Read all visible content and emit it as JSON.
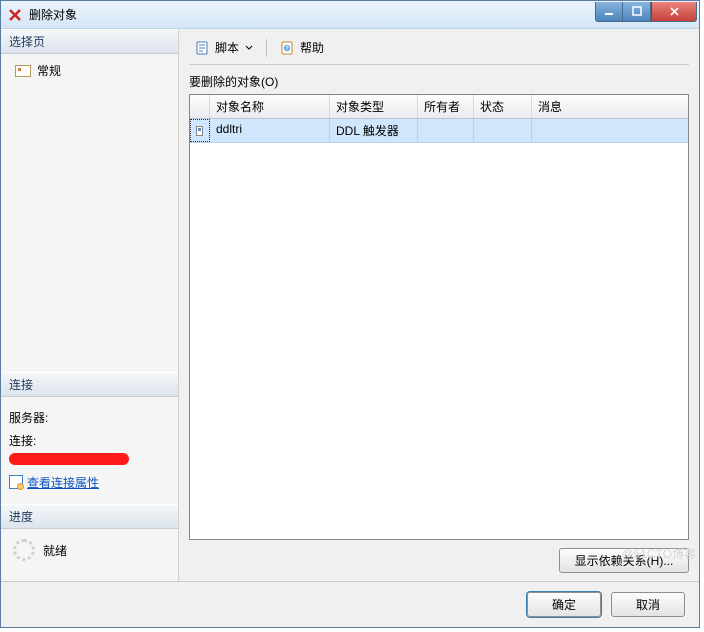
{
  "title": "删除对象",
  "sidebar": {
    "select_page": "选择页",
    "items": [
      {
        "label": "常规"
      }
    ],
    "connection_header": "连接",
    "server_label": "服务器:",
    "server_value": "",
    "conn_label": "连接:",
    "view_conn_props": "查看连接属性",
    "progress_header": "进度",
    "progress_status": "就绪"
  },
  "toolbar": {
    "script_label": "脚本",
    "help_label": "帮助"
  },
  "grid": {
    "label_prefix": "要删除的对象",
    "label_hotkey": "(O)",
    "headers": {
      "name": "对象名称",
      "type": "对象类型",
      "owner": "所有者",
      "state": "状态",
      "msg": "消息"
    },
    "rows": [
      {
        "name": "ddltri",
        "type": "DDL 触发器",
        "owner": "",
        "state": "",
        "msg": ""
      }
    ]
  },
  "buttons": {
    "show_deps": "显示依赖关系(H)...",
    "ok": "确定",
    "cancel": "取消"
  },
  "watermark": "@51CTO博客"
}
